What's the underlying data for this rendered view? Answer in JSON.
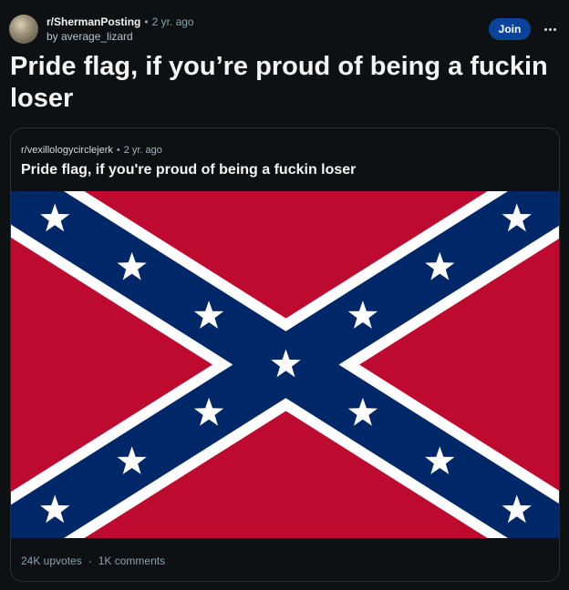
{
  "post": {
    "subreddit": "r/ShermanPosting",
    "separator": "•",
    "time": "2 yr. ago",
    "byline": "by average_lizard",
    "join_label": "Join",
    "title": "Pride flag, if you’re proud of being a fuckin loser"
  },
  "crosspost": {
    "subreddit": "r/vexillologycirclejerk",
    "separator": "•",
    "time": "2 yr. ago",
    "title": "Pride flag, if you're proud of being a fuckin loser",
    "upvotes": "24K upvotes",
    "dot": "·",
    "comments": "1K comments"
  },
  "colors": {
    "flag_red": "#bf0a30",
    "flag_blue": "#002868",
    "join_button": "#0a449b",
    "background": "#0e1113"
  },
  "icons": {
    "avatar": "subreddit-avatar",
    "more": "ellipsis-icon",
    "star": "star-icon"
  }
}
